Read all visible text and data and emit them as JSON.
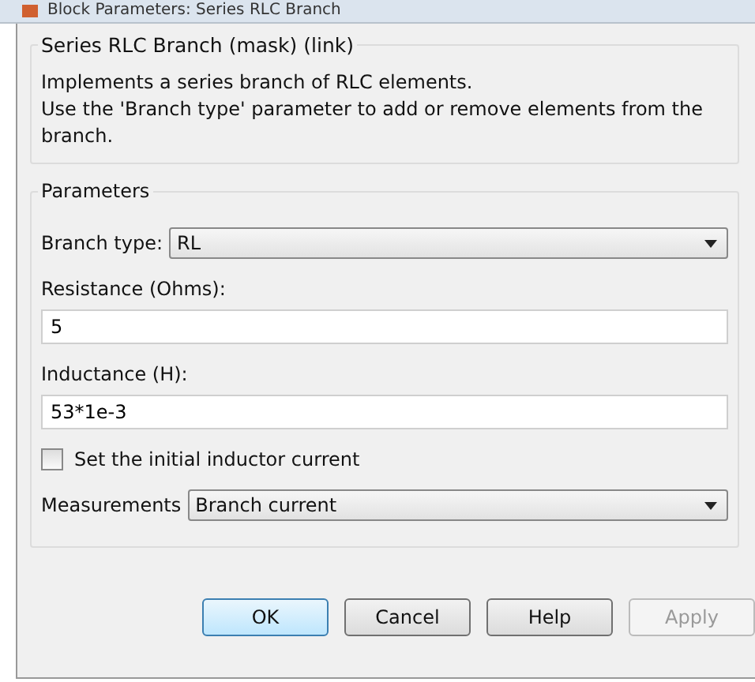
{
  "window": {
    "title": "Block Parameters: Series RLC Branch"
  },
  "description": {
    "title": "Series RLC Branch (mask) (link)",
    "lines": [
      "Implements a series branch of RLC elements.",
      "Use the 'Branch type' parameter to add or remove elements from the branch."
    ]
  },
  "parameters": {
    "title": "Parameters",
    "items": [
      {
        "kind": "dropdown",
        "label": "Branch type:",
        "value": "RL"
      },
      {
        "kind": "field",
        "label": "Resistance (Ohms):",
        "value": "5"
      },
      {
        "kind": "field",
        "label": "Inductance (H):",
        "value": "53*1e-3"
      },
      {
        "kind": "checkbox",
        "label": "Set the initial inductor current",
        "checked": false
      },
      {
        "kind": "dropdown",
        "label": "Measurements",
        "value": "Branch current"
      }
    ]
  },
  "buttons": [
    {
      "label": "OK",
      "default": true,
      "disabled": false
    },
    {
      "label": "Cancel",
      "default": false,
      "disabled": false
    },
    {
      "label": "Help",
      "default": false,
      "disabled": false
    },
    {
      "label": "Apply",
      "default": false,
      "disabled": true
    }
  ]
}
